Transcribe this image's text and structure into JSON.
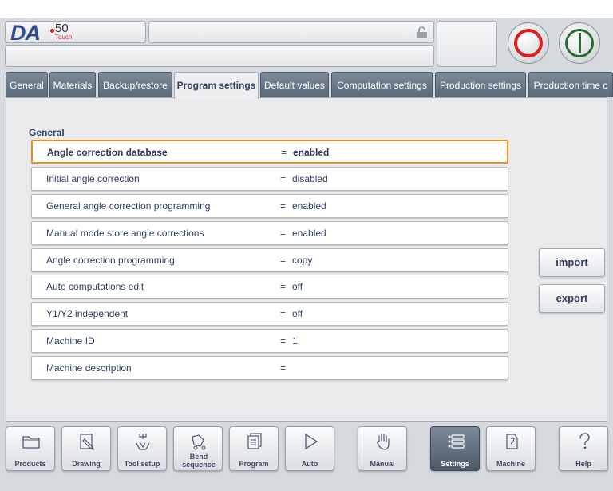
{
  "logo": {
    "brand": "DA",
    "model": "50",
    "sub": "Touch"
  },
  "header": {
    "title": "",
    "message": ""
  },
  "tabs": [
    {
      "label": "General"
    },
    {
      "label": "Materials"
    },
    {
      "label": "Backup/restore"
    },
    {
      "label": "Program settings"
    },
    {
      "label": "Default values"
    },
    {
      "label": "Computation settings"
    },
    {
      "label": "Production settings"
    },
    {
      "label": "Production time c"
    }
  ],
  "active_tab": "Program settings",
  "section": {
    "title": "General"
  },
  "params": [
    {
      "label": "Angle correction database",
      "eq": "=",
      "value": "enabled"
    },
    {
      "label": "Initial angle correction",
      "eq": "=",
      "value": "disabled"
    },
    {
      "label": "General angle correction programming",
      "eq": "=",
      "value": "enabled"
    },
    {
      "label": "Manual mode store angle corrections",
      "eq": "=",
      "value": "enabled"
    },
    {
      "label": "Angle correction programming",
      "eq": "=",
      "value": "copy"
    },
    {
      "label": "Auto computations edit",
      "eq": "=",
      "value": "off"
    },
    {
      "label": "Y1/Y2 independent",
      "eq": "=",
      "value": "off"
    },
    {
      "label": "Machine ID",
      "eq": "=",
      "value": "1"
    },
    {
      "label": "Machine description",
      "eq": "=",
      "value": ""
    }
  ],
  "selected_param": "Angle correction database",
  "actions": {
    "import": "import",
    "export": "export"
  },
  "nav": [
    {
      "label": "Products",
      "icon": "folder-icon"
    },
    {
      "label": "Drawing",
      "icon": "pencil-icon"
    },
    {
      "label": "Tool setup",
      "icon": "tool-icon"
    },
    {
      "label": "Bend sequence",
      "icon": "bend-icon"
    },
    {
      "label": "Program",
      "icon": "pages-icon"
    },
    {
      "label": "Auto",
      "icon": "play-icon"
    },
    {
      "label": "Manual",
      "icon": "hand-icon"
    },
    {
      "label": "Settings",
      "icon": "list-icon"
    },
    {
      "label": "Machine",
      "icon": "machine-icon"
    },
    {
      "label": "Help",
      "icon": "question-icon"
    }
  ],
  "active_nav": "Settings",
  "colors": {
    "accent": "#2e3e62",
    "selection": "#e89020",
    "stop": "#e01c1c",
    "start": "#2b6a34",
    "logo": "#2f4d8c"
  }
}
